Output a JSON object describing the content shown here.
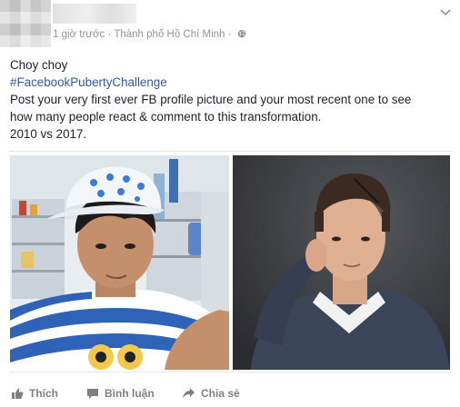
{
  "post": {
    "timestamp": "1 giờ trước",
    "separator": "·",
    "location": "Thành phố Hồ Chí Minh",
    "text_lines": {
      "line1": "Choy choy",
      "hashtag": "#FacebookPubertyChallenge",
      "line3": "Post your very first ever FB profile picture and your most recent one to see",
      "line4": "how many people react & comment to this transformation.",
      "line5": "2010 vs 2017."
    }
  },
  "actions": {
    "like_label": "Thích",
    "comment_label": "Bình luận",
    "share_label": "Chia sẻ"
  },
  "colors": {
    "hashtag": "#365899",
    "meta": "#90949c",
    "action": "#7f7f7f"
  },
  "icons": [
    "globe-icon",
    "chevron-down-icon",
    "like-icon",
    "comment-icon",
    "share-icon"
  ]
}
